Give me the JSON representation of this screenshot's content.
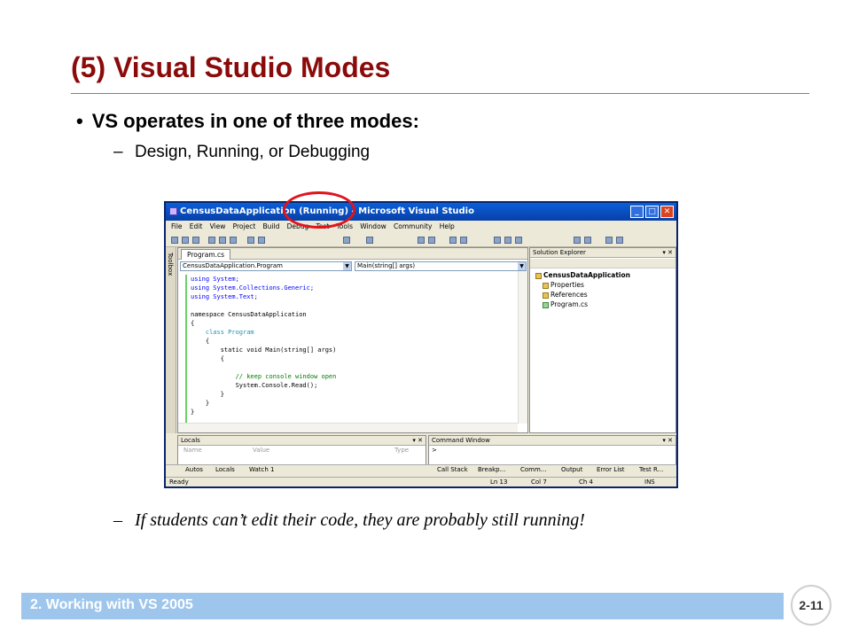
{
  "slide": {
    "title": "(5) Visual Studio Modes",
    "bullet": "VS operates in one of three modes:",
    "bullet_marker": "•",
    "sub_dash": "–",
    "sub_bullet_1": "Design, Running, or Debugging",
    "sub_bullet_2": "If students can’t edit their code, they are probably still running!",
    "footer": "2. Working with VS 2005",
    "page_number": "2-11",
    "colors": {
      "title": "#8b0a0a",
      "footer_bar": "#9ec6ec",
      "highlight_circle": "#e0141e"
    }
  },
  "vs_window": {
    "title": "CensusDataApplication (Running) - Microsoft Visual Studio",
    "buttons": {
      "minimize": "_",
      "maximize": "□",
      "close": "✕"
    },
    "menu": [
      "File",
      "Edit",
      "View",
      "Project",
      "Build",
      "Debug",
      "Test",
      "Tools",
      "Window",
      "Community",
      "Help"
    ],
    "toolbox_label": "Toolbox",
    "doc_tab": "Program.cs",
    "class_combo": "CensusDataApplication.Program",
    "member_combo": "Main(string[] args)",
    "code_lines": [
      "using System;",
      "using System.Collections.Generic;",
      "using System.Text;",
      "",
      "namespace CensusDataApplication",
      "{",
      "    class Program",
      "    {",
      "        static void Main(string[] args)",
      "        {",
      "",
      "            // keep console window open",
      "            System.Console.Read();",
      "        }",
      "    }",
      "}"
    ],
    "solution_explorer": {
      "title": "Solution Explorer",
      "items": [
        "CensusDataApplication",
        "Properties",
        "References",
        "Program.cs"
      ]
    },
    "locals": {
      "title": "Locals",
      "columns": [
        "Name",
        "Value",
        "Type"
      ]
    },
    "command_window": {
      "title": "Command Window",
      "prompt": ">"
    },
    "bottom_tabs_left": [
      "Autos",
      "Locals",
      "Watch 1"
    ],
    "bottom_tabs_right": [
      "Call Stack",
      "Breakp...",
      "Comm...",
      "Output",
      "Error List",
      "Test R..."
    ],
    "status": {
      "text": "Ready",
      "ln": "Ln 13",
      "col": "Col 7",
      "ch": "Ch 4",
      "mode": "INS"
    }
  }
}
